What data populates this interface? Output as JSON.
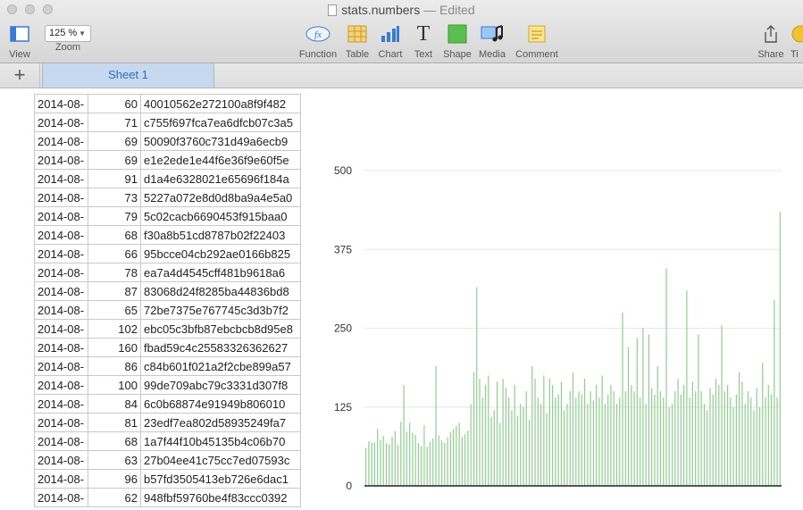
{
  "window": {
    "filename": "stats.numbers",
    "status": "— Edited"
  },
  "toolbar": {
    "view": "View",
    "zoom_value": "125 %",
    "zoom": "Zoom",
    "function": "Function",
    "function_badge": "fx",
    "table": "Table",
    "chart": "Chart",
    "text": "Text",
    "text_glyph": "T",
    "shape": "Shape",
    "media": "Media",
    "comment": "Comment",
    "share": "Share",
    "tips": "Ti"
  },
  "sheets": {
    "add": "+",
    "active": "Sheet 1"
  },
  "table": {
    "rows": [
      {
        "date": "2014-08-",
        "value": "60",
        "hash": "40010562e272100a8f9f482"
      },
      {
        "date": "2014-08-",
        "value": "71",
        "hash": "c755f697fca7ea6dfcb07c3a5"
      },
      {
        "date": "2014-08-",
        "value": "69",
        "hash": "50090f3760c731d49a6ecb9"
      },
      {
        "date": "2014-08-",
        "value": "69",
        "hash": "e1e2ede1e44f6e36f9e60f5e"
      },
      {
        "date": "2014-08-",
        "value": "91",
        "hash": "d1a4e6328021e65696f184a"
      },
      {
        "date": "2014-08-",
        "value": "73",
        "hash": "5227a072e8d0d8ba9a4e5a0"
      },
      {
        "date": "2014-08-",
        "value": "79",
        "hash": "5c02cacb6690453f915baa0"
      },
      {
        "date": "2014-08-",
        "value": "68",
        "hash": "f30a8b51cd8787b02f22403"
      },
      {
        "date": "2014-08-",
        "value": "66",
        "hash": "95bcce04cb292ae0166b825"
      },
      {
        "date": "2014-08-",
        "value": "78",
        "hash": "ea7a4d4545cff481b9618a6"
      },
      {
        "date": "2014-08-",
        "value": "87",
        "hash": "83068d24f8285ba44836bd8"
      },
      {
        "date": "2014-08-",
        "value": "65",
        "hash": "72be7375e767745c3d3b7f2"
      },
      {
        "date": "2014-08-",
        "value": "102",
        "hash": "ebc05c3bfb87ebcbcb8d95e8"
      },
      {
        "date": "2014-08-",
        "value": "160",
        "hash": "fbad59c4c25583326362627"
      },
      {
        "date": "2014-08-",
        "value": "86",
        "hash": "c84b601f021a2f2cbe899a57"
      },
      {
        "date": "2014-08-",
        "value": "100",
        "hash": "99de709abc79c3331d307f8"
      },
      {
        "date": "2014-08-",
        "value": "84",
        "hash": "6c0b68874e91949b806010"
      },
      {
        "date": "2014-08-",
        "value": "81",
        "hash": "23edf7ea802d58935249fa7"
      },
      {
        "date": "2014-08-",
        "value": "68",
        "hash": "1a7f44f10b45135b4c06b70"
      },
      {
        "date": "2014-08-",
        "value": "63",
        "hash": "27b04ee41c75cc7ed07593c"
      },
      {
        "date": "2014-08-",
        "value": "96",
        "hash": "b57fd3505413eb726e6dac1"
      },
      {
        "date": "2014-08-",
        "value": "62",
        "hash": "948fbf59760be4f83ccc0392"
      }
    ]
  },
  "chart_data": {
    "type": "bar",
    "ylim": [
      0,
      500
    ],
    "yticks": [
      "0",
      "125",
      "250",
      "375",
      "500"
    ],
    "grid": true,
    "bar_color": "#8fd08f",
    "values": [
      60,
      71,
      69,
      69,
      91,
      73,
      79,
      68,
      66,
      78,
      87,
      65,
      102,
      160,
      86,
      100,
      84,
      81,
      68,
      63,
      96,
      62,
      70,
      75,
      190,
      80,
      72,
      68,
      77,
      85,
      90,
      95,
      100,
      78,
      82,
      88,
      130,
      180,
      315,
      170,
      140,
      160,
      175,
      110,
      120,
      165,
      100,
      170,
      155,
      140,
      120,
      160,
      110,
      130,
      125,
      150,
      105,
      190,
      170,
      140,
      130,
      175,
      115,
      170,
      160,
      140,
      145,
      165,
      120,
      130,
      150,
      180,
      140,
      150,
      145,
      170,
      130,
      150,
      135,
      160,
      140,
      175,
      130,
      145,
      160,
      150,
      130,
      140,
      275,
      150,
      220,
      160,
      150,
      235,
      140,
      250,
      130,
      240,
      155,
      145,
      190,
      150,
      140,
      345,
      125,
      130,
      150,
      170,
      145,
      160,
      310,
      140,
      165,
      150,
      240,
      150,
      130,
      120,
      155,
      145,
      170,
      160,
      255,
      150,
      160,
      140,
      125,
      145,
      180,
      165,
      130,
      150,
      140,
      120,
      155,
      125,
      195,
      140,
      160,
      145,
      295,
      140,
      435
    ],
    "accent": "#2d6fc3"
  }
}
